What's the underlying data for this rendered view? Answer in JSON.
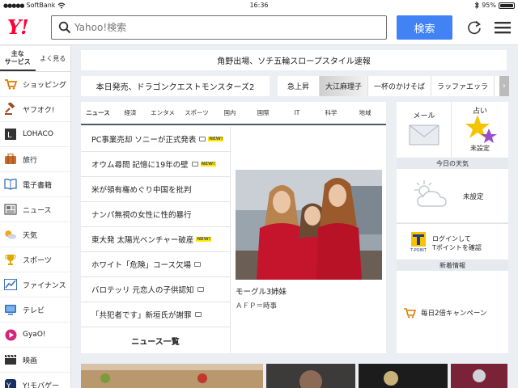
{
  "status_bar": {
    "carrier": "SoftBank",
    "time": "16:36",
    "battery": "95%",
    "battery_level": 0.95
  },
  "header": {
    "logo": "Y!",
    "search_placeholder": "Yahoo!検索",
    "search_button": "検索"
  },
  "sidebar": {
    "tabs": [
      {
        "label": "主な\nサービス"
      },
      {
        "label": "よく見る"
      }
    ],
    "items": [
      {
        "label": "ショッピング",
        "icon": "shopping-cart-icon"
      },
      {
        "label": "ヤフオク!",
        "icon": "auction-gavel-icon"
      },
      {
        "label": "LOHACO",
        "icon": "lohaco-icon"
      },
      {
        "label": "旅行",
        "icon": "suitcase-icon"
      },
      {
        "label": "電子書籍",
        "icon": "book-icon"
      },
      {
        "label": "ニュース",
        "icon": "news-icon"
      },
      {
        "label": "天気",
        "icon": "weather-icon"
      },
      {
        "label": "スポーツ",
        "icon": "trophy-icon"
      },
      {
        "label": "ファイナンス",
        "icon": "chart-icon"
      },
      {
        "label": "テレビ",
        "icon": "tv-icon"
      },
      {
        "label": "GyaO!",
        "icon": "play-icon"
      },
      {
        "label": "映画",
        "icon": "movie-icon"
      },
      {
        "label": "Y!モバゲー",
        "icon": "mobage-icon"
      }
    ]
  },
  "banners": {
    "top": "角野出場、ソチ五輪スロープスタイル速報",
    "second": "本日発売、ドラゴンクエストモンスターズ2"
  },
  "trends": {
    "label": "急上昇",
    "items": [
      "大江麻理子",
      "一杯のかけそば",
      "ラッファエッラ"
    ]
  },
  "news": {
    "tabs": [
      "ニュース",
      "経済",
      "エンタメ",
      "スポーツ",
      "国内",
      "国際",
      "IT",
      "科学",
      "地域"
    ],
    "headlines": [
      {
        "text": "PC事業売却 ソニーが正式発表",
        "photo": true,
        "new_label": "NEW!"
      },
      {
        "text": "オウム尋問 記憶に19年の壁",
        "photo": true,
        "new_label": "NEW!"
      },
      {
        "text": "米が領有権めぐり中国を批判",
        "photo": false,
        "new_label": ""
      },
      {
        "text": "ナンパ無視の女性に性的暴行",
        "photo": false,
        "new_label": ""
      },
      {
        "text": "東大発 太陽光ベンチャー破産",
        "photo": false,
        "new_label": "NEW!"
      },
      {
        "text": "ホワイト「危険」コース欠場",
        "photo": true,
        "new_label": ""
      },
      {
        "text": "バロテッリ 元恋人の子供認知",
        "photo": true,
        "new_label": ""
      },
      {
        "text": "「共犯者です」新垣氏が謝罪",
        "photo": true,
        "new_label": ""
      }
    ],
    "more": "ニュース一覧",
    "photo_caption": "モーグル3姉妹",
    "photo_source": "ＡＦＰ＝時事"
  },
  "right": {
    "mail": "メール",
    "fortune": "占い",
    "fortune_status": "未設定",
    "weather_head": "今日の天気",
    "weather_status": "未設定",
    "tpoint_line1": "ログインして",
    "tpoint_line2": "Tポイントを確認",
    "tpoint_logo": "T-POINT",
    "info_head": "新着情報",
    "info_text": "毎日2倍キャンペーン"
  },
  "colors": {
    "brand": "#ff0033",
    "search_button": "#4183f4",
    "background": "#ebeef2"
  }
}
